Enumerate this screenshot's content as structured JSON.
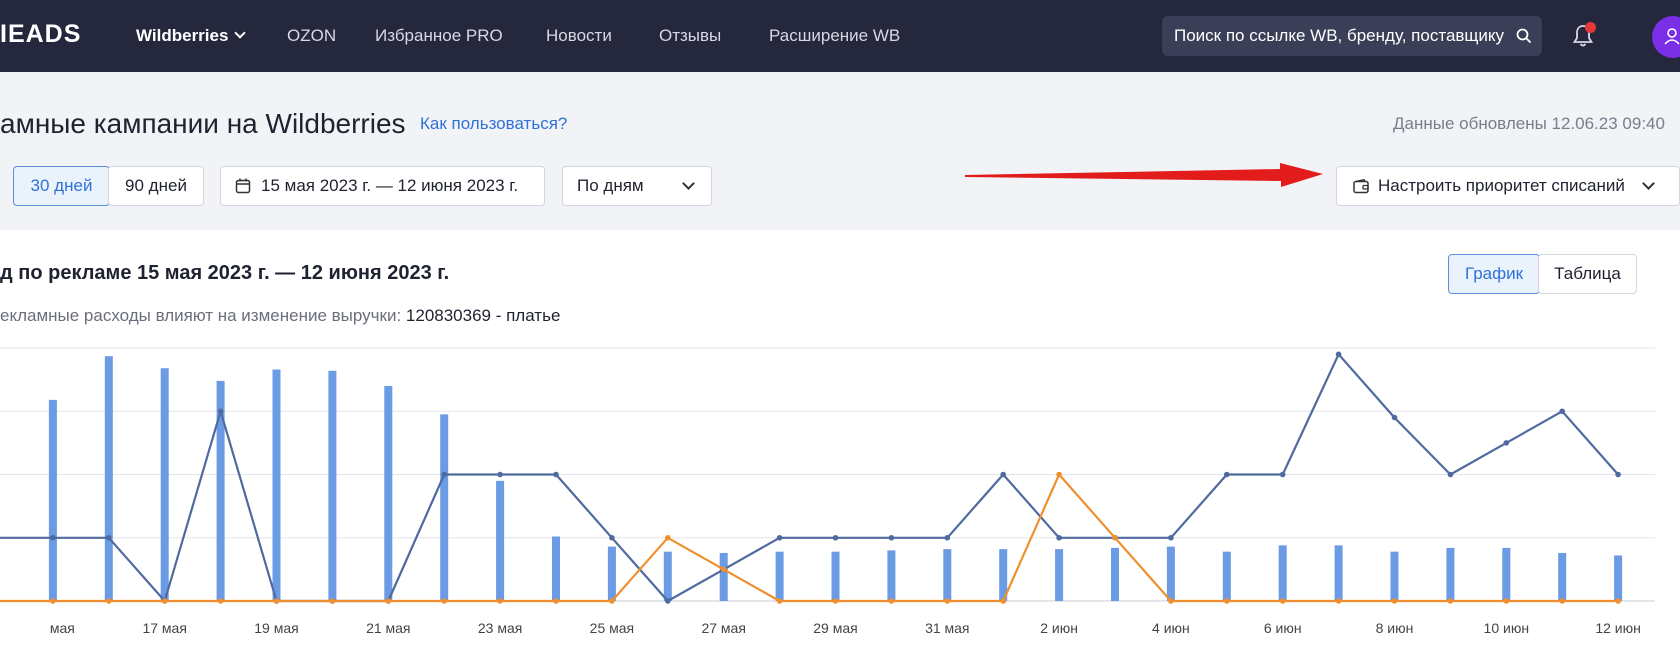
{
  "topbar": {
    "logo": "IEADS",
    "nav": [
      {
        "label": "Wildberries"
      },
      {
        "label": "OZON"
      },
      {
        "label": "Избранное PRO"
      },
      {
        "label": "Новости"
      },
      {
        "label": "Отзывы"
      },
      {
        "label": "Расширение WB"
      }
    ],
    "search_value": "Поиск по ссылке WB, бренду, поставщику"
  },
  "page": {
    "title": "амные кампании на Wildberries",
    "howto_link": "Как пользоваться?",
    "updated": "Данные обновлены 12.06.23 09:40"
  },
  "filters": {
    "period_30": "30 дней",
    "period_90": "90 дней",
    "date_range": "15 мая 2023 г. — 12 июня 2023 г.",
    "group_by": "По дням",
    "priority_button": "Настроить приоритет списаний"
  },
  "card": {
    "title": "д по рекламе 15 мая 2023 г. — 12 июня 2023 г.",
    "subtitle_prefix": "екламные расходы влияют на изменение выручки: ",
    "subtitle_product": "120830369 - платье",
    "view_graph": "График",
    "view_table": "Таблица"
  },
  "colors": {
    "bar": "#6a9be4",
    "line_blue": "#4f6a9e",
    "line_orange": "#ef8f2e",
    "accent": "#2f72d6",
    "topbar": "#25283d",
    "arrow": "#e21b1b"
  },
  "chart_data": {
    "type": "bar",
    "x": [
      "15 мая",
      "16 мая",
      "17 мая",
      "18 мая",
      "19 мая",
      "20 мая",
      "21 мая",
      "22 мая",
      "23 мая",
      "24 мая",
      "25 мая",
      "26 мая",
      "27 мая",
      "28 мая",
      "29 мая",
      "30 мая",
      "31 мая",
      "1 июн",
      "2 июн",
      "3 июн",
      "4 июн",
      "5 июн",
      "6 июн",
      "7 июн",
      "8 июн",
      "9 июн",
      "10 июн",
      "11 июн",
      "12 июн"
    ],
    "tick_labels": [
      "мая",
      "17 мая",
      "19 мая",
      "21 мая",
      "23 мая",
      "25 мая",
      "27 мая",
      "29 мая",
      "31 мая",
      "2 июн",
      "4 июн",
      "6 июн",
      "8 июн",
      "10 июн",
      "12 июн"
    ],
    "tick_indices": [
      0,
      2,
      4,
      6,
      8,
      10,
      12,
      14,
      16,
      18,
      20,
      22,
      24,
      26,
      28
    ],
    "ylim": [
      0,
      4
    ],
    "gridlines": [
      0,
      1,
      2,
      3,
      4
    ],
    "series": [
      {
        "style": "bar",
        "values": [
          0,
          3.18,
          3.87,
          3.68,
          3.48,
          3.66,
          3.64,
          3.4,
          2.95,
          1.9,
          1.02,
          0.86,
          0.78,
          0.76,
          0.78,
          0.78,
          0.8,
          0.82,
          0.82,
          0.82,
          0.84,
          0.86,
          0.78,
          0.88,
          0.88,
          0.78,
          0.84,
          0.84,
          0.76,
          0.72
        ]
      },
      {
        "style": "line",
        "values": [
          1,
          1,
          1,
          0,
          3,
          0,
          0,
          0,
          2,
          2,
          2,
          1,
          0,
          0.5,
          1,
          1,
          1,
          1,
          2,
          1,
          1,
          1,
          2,
          2,
          3.9,
          2.9,
          2,
          2.5,
          3,
          2
        ]
      },
      {
        "style": "line",
        "values": [
          0,
          0,
          0,
          0,
          0,
          0,
          0,
          0,
          0,
          0,
          0,
          0,
          1,
          0.5,
          0,
          0,
          0,
          0,
          0,
          2,
          1,
          0,
          0,
          0,
          0,
          0,
          0,
          0,
          0,
          0
        ]
      }
    ]
  }
}
